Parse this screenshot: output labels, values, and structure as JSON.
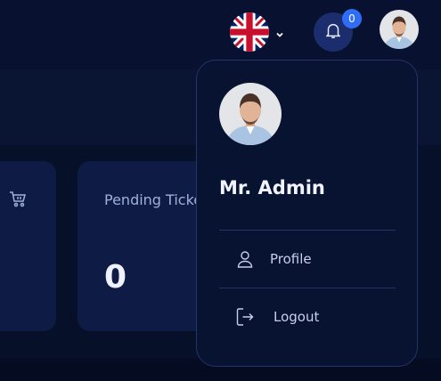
{
  "header": {
    "language": {
      "icon": "uk-flag-icon"
    },
    "notifications": {
      "count": "0",
      "icon": "bell-icon"
    },
    "user_avatar": {
      "icon": "avatar"
    }
  },
  "cards": [
    {
      "icon": "cart-icon"
    },
    {
      "label": "Pending Tickets",
      "value": "0"
    }
  ],
  "dropdown": {
    "name": "Mr. Admin",
    "items": [
      {
        "label": "Profile",
        "icon": "user-icon"
      },
      {
        "label": "Logout",
        "icon": "logout-icon"
      }
    ]
  },
  "colors": {
    "background": "#050c22",
    "panel": "#081231",
    "card": "#0e1c45",
    "accent": "#2f6df6",
    "text": "#c6d0ee"
  }
}
